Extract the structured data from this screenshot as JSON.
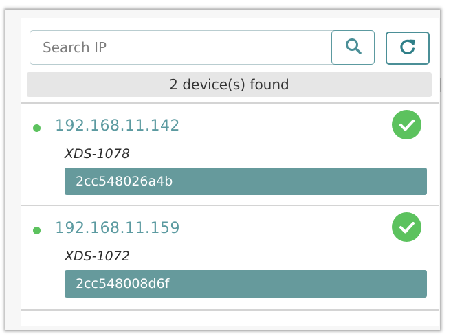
{
  "search": {
    "placeholder": "Search IP",
    "value": ""
  },
  "icons": {
    "search": "search-icon",
    "refresh": "refresh-icon",
    "status_dot": "status-dot-icon",
    "check": "check-circle-icon"
  },
  "status_text": "2 device(s) found",
  "devices": [
    {
      "ip": "192.168.11.142",
      "model": "XDS-1078",
      "mac": "2cc548026a4b",
      "online": true,
      "verified": true
    },
    {
      "ip": "192.168.11.159",
      "model": "XDS-1072",
      "mac": "2cc548008d6f",
      "online": true,
      "verified": true
    }
  ],
  "colors": {
    "accent": "#5b9aa0",
    "online_green": "#5cc25e",
    "mac_badge": "#669a9c",
    "status_bar_bg": "#e6e6e6"
  }
}
